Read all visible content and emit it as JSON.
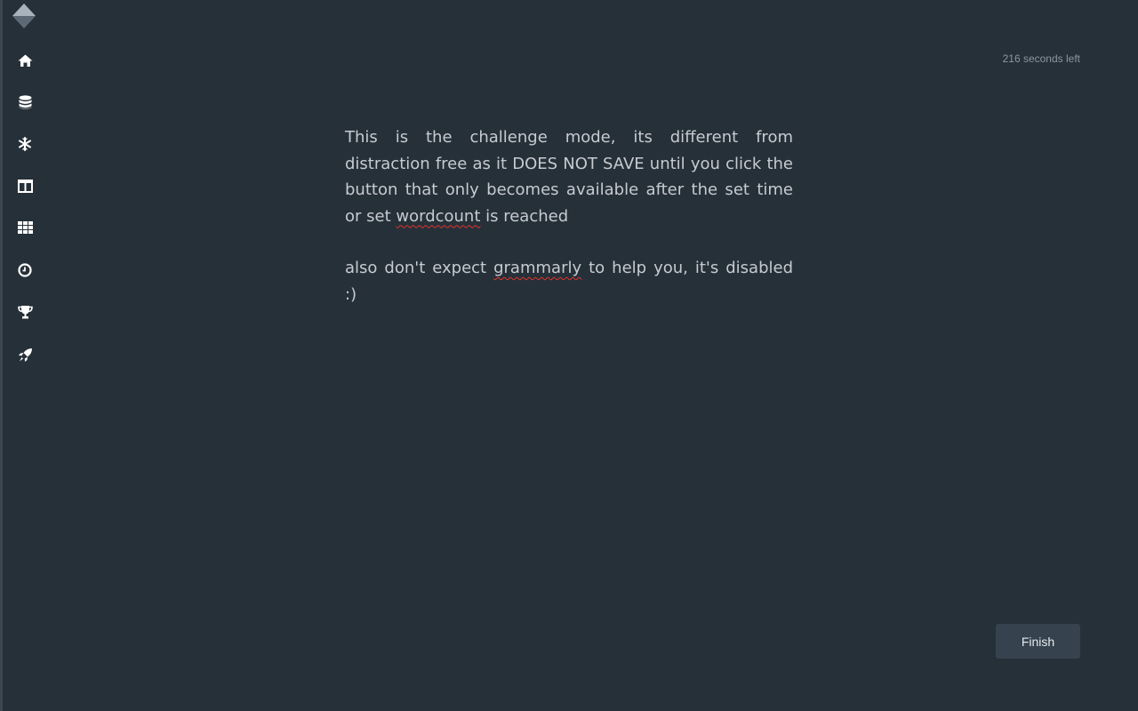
{
  "sidebar": {
    "logo": "diamond-logo",
    "items": [
      {
        "icon": "home-icon"
      },
      {
        "icon": "database-icon"
      },
      {
        "icon": "snowflake-icon"
      },
      {
        "icon": "columns-icon"
      },
      {
        "icon": "grid-icon"
      },
      {
        "icon": "clock-icon"
      },
      {
        "icon": "trophy-icon"
      },
      {
        "icon": "rocket-icon"
      }
    ]
  },
  "timer": {
    "text": "216 seconds left"
  },
  "editor": {
    "paragraph1": {
      "part1": "This is the challenge mode, its different from distraction free as it DOES NOT SAVE until you click the button that only becomes available after the set time or set ",
      "misspelled": "wordcount",
      "part2": " is reached"
    },
    "paragraph2": {
      "part1": "also don't expect ",
      "misspelled": "grammarly",
      "part2": " to help you, it's disabled :)"
    }
  },
  "finish_button": {
    "label": "Finish"
  },
  "colors": {
    "background": "#263039",
    "button_background": "#36434e",
    "text": "#c6cbd0",
    "spellcheck_underline": "#e0342c"
  }
}
